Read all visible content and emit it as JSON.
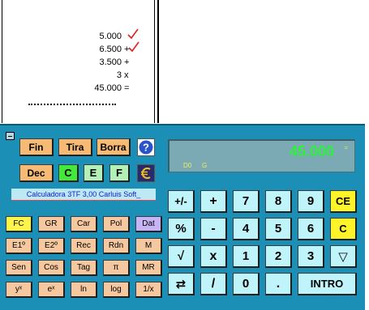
{
  "tape": {
    "rows": [
      {
        "value": "5.000",
        "op": "",
        "check": true
      },
      {
        "value": "6.500",
        "op": "+",
        "check": true
      },
      {
        "value": "3.500",
        "op": "+",
        "check": false
      },
      {
        "value": "3",
        "op": "x",
        "check": false
      },
      {
        "value": "45.000",
        "op": "=",
        "check": false
      }
    ]
  },
  "display": {
    "value": "45.000",
    "eq_sign": "=",
    "mode_d0": "D0",
    "mode_g": "G"
  },
  "top_buttons": {
    "fin": "Fin",
    "tira": "Tira",
    "borra": "Borra",
    "dec": "Dec",
    "c": "C",
    "e": "E",
    "f": "F"
  },
  "title_link": "Calculadora 3TF 3,00 Carluis Soft_",
  "func_keys": {
    "row1": [
      "FC",
      "GR",
      "Car",
      "Pol",
      "Dat"
    ],
    "row2": [
      "E1º",
      "E2º",
      "Rec",
      "Rdn",
      "M"
    ],
    "row3": [
      "Sen",
      "Cos",
      "Tag",
      "π",
      "MR"
    ],
    "row4": [
      "yˣ",
      "eˣ",
      "ln",
      "log",
      "1/x"
    ]
  },
  "num_keys": {
    "row1": [
      "+/-",
      "+",
      "7",
      "8",
      "9",
      "CE"
    ],
    "row2": [
      "%",
      "-",
      "4",
      "5",
      "6",
      "C"
    ],
    "row3": [
      "√",
      "x",
      "1",
      "2",
      "3",
      "▽"
    ],
    "row4": [
      "⇄",
      "/",
      "0",
      ".",
      "INTRO"
    ]
  },
  "colors": {
    "body": "#1c8fb6",
    "display_bg": "#7ba9b4",
    "display_text": "#2cf23a",
    "check_mark": "#e02020",
    "title_link": "#0b1bd0"
  },
  "icons": {
    "help": "help-icon",
    "euro": "euro-icon",
    "check": "check-icon",
    "minimize": "minimize-icon"
  }
}
